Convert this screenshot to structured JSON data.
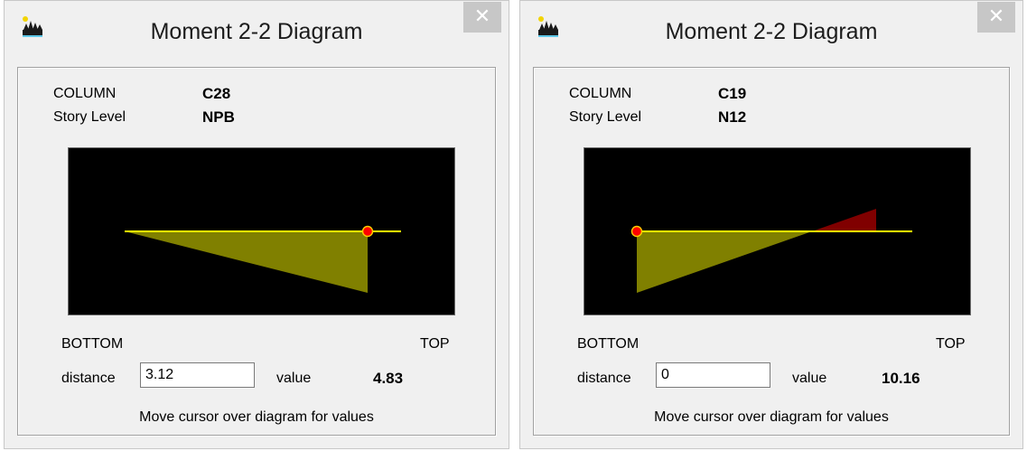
{
  "windows": [
    {
      "title": "Moment 2-2 Diagram",
      "close_glyph": "✕",
      "column_label": "COLUMN",
      "column_value": "C28",
      "story_label": "Story Level",
      "story_value": "NPB",
      "bottom_label": "BOTTOM",
      "top_label": "TOP",
      "distance_label": "distance",
      "distance_value": "3.12",
      "value_label": "value",
      "value": "4.83",
      "hint": "Move cursor over diagram for values",
      "icon": "app-icon",
      "colors": {
        "fill": "#808000",
        "axis": "#ffff00",
        "marker": "#ff0000"
      }
    },
    {
      "title": "Moment 2-2 Diagram",
      "close_glyph": "✕",
      "column_label": "COLUMN",
      "column_value": "C19",
      "story_label": "Story Level",
      "story_value": "N12",
      "bottom_label": "BOTTOM",
      "top_label": "TOP",
      "distance_label": "distance",
      "distance_value": "0",
      "value_label": "value",
      "value": "10.16",
      "hint": "Move cursor over diagram for values",
      "icon": "app-icon",
      "colors": {
        "fill": "#808000",
        "negative_fill": "#800000",
        "axis": "#ffff00",
        "marker": "#ff0000"
      }
    }
  ]
}
